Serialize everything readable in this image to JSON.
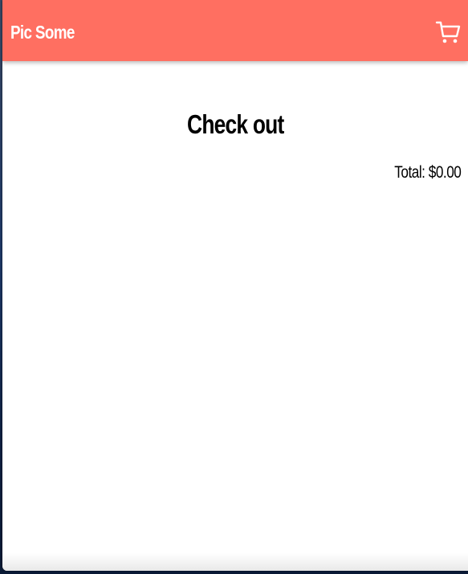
{
  "navbar": {
    "brand": "Pic Some",
    "cart_icon": "cart-icon",
    "color": "#ff6f61"
  },
  "main": {
    "title": "Check out",
    "total_text": "Total: $0.00"
  }
}
